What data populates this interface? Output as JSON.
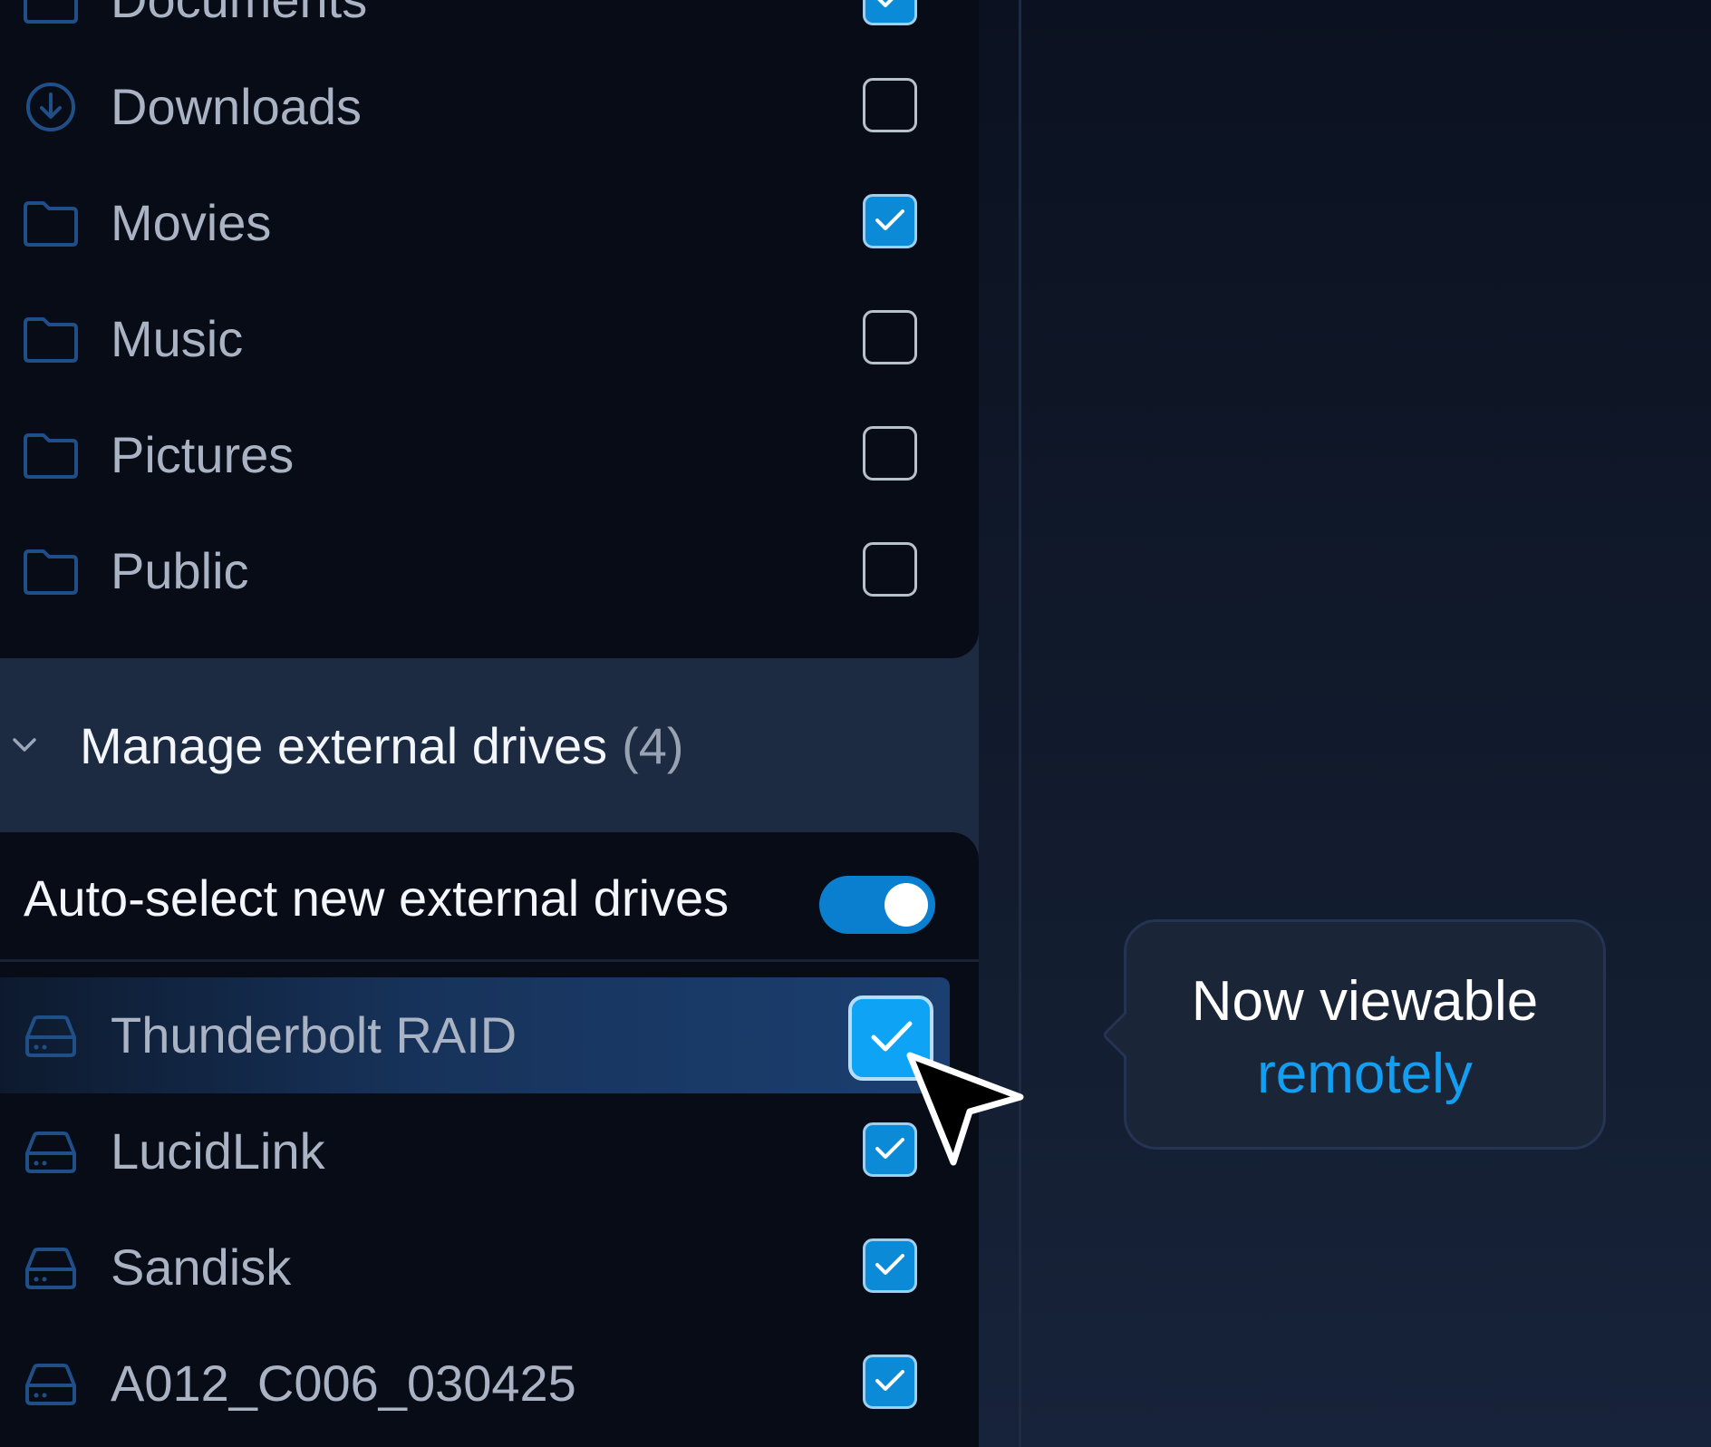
{
  "colors": {
    "accent": "#0ea3f5",
    "checkbox_checked": "#0b8ad8",
    "panel_bg": "#1c2a42",
    "card_bg": "#070c16",
    "tooltip_highlight": "#139ef2"
  },
  "folders": {
    "items": [
      {
        "label": "Documents",
        "icon": "folder-icon",
        "checked": true
      },
      {
        "label": "Downloads",
        "icon": "download-circle-icon",
        "checked": false
      },
      {
        "label": "Movies",
        "icon": "folder-icon",
        "checked": true
      },
      {
        "label": "Music",
        "icon": "folder-icon",
        "checked": false
      },
      {
        "label": "Pictures",
        "icon": "folder-icon",
        "checked": false
      },
      {
        "label": "Public",
        "icon": "folder-icon",
        "checked": false
      }
    ]
  },
  "external": {
    "title": "Manage external drives",
    "count": "(4)",
    "chevron_icon": "chevron-down-icon",
    "auto_select_label": "Auto-select new external drives",
    "auto_select_on": true,
    "drives": [
      {
        "label": "Thunderbolt RAID",
        "icon": "drive-icon",
        "checked": true,
        "highlighted": true
      },
      {
        "label": "LucidLink",
        "icon": "drive-icon",
        "checked": true
      },
      {
        "label": "Sandisk",
        "icon": "drive-icon",
        "checked": true
      },
      {
        "label": "A012_C006_030425",
        "icon": "drive-icon",
        "checked": true
      }
    ]
  },
  "tooltip": {
    "line1": "Now viewable",
    "line2": "remotely"
  },
  "cursor_icon": "pointer-cursor-icon"
}
